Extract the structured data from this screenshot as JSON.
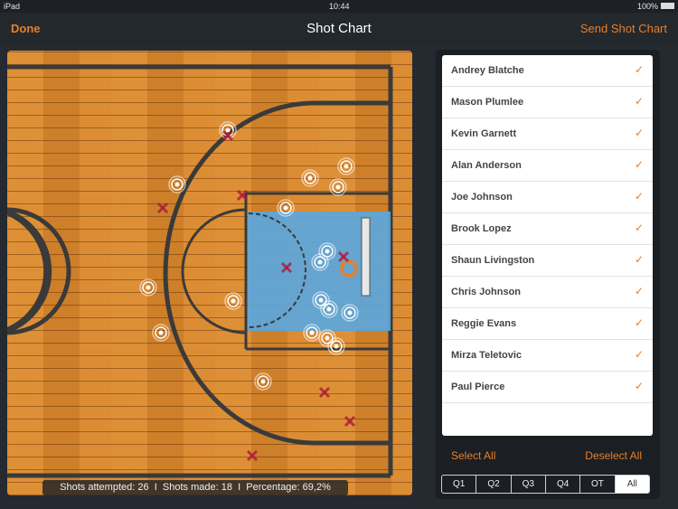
{
  "status": {
    "device": "iPad",
    "time": "10:44",
    "battery": "100%"
  },
  "nav": {
    "done": "Done",
    "title": "Shot Chart",
    "send": "Send Shot Chart"
  },
  "stats": {
    "attempted": "Shots attempted: 26",
    "made": "Shots made: 18",
    "percentage": "Percentage: 69,2%",
    "separator": "I"
  },
  "players": [
    {
      "name": "Andrey Blatche",
      "checked": true
    },
    {
      "name": "Mason Plumlee",
      "checked": true
    },
    {
      "name": "Kevin Garnett",
      "checked": true
    },
    {
      "name": "Alan Anderson",
      "checked": true
    },
    {
      "name": "Joe Johnson",
      "checked": true
    },
    {
      "name": "Brook Lopez",
      "checked": true
    },
    {
      "name": "Shaun Livingston",
      "checked": true
    },
    {
      "name": "Chris Johnson",
      "checked": true
    },
    {
      "name": "Reggie Evans",
      "checked": true
    },
    {
      "name": "Mirza Teletovic",
      "checked": true
    },
    {
      "name": "Paul Pierce",
      "checked": true
    }
  ],
  "check_glyph": "✓",
  "actions": {
    "select_all": "Select All",
    "deselect_all": "Deselect All"
  },
  "quarters": [
    "Q1",
    "Q2",
    "Q3",
    "Q4",
    "OT",
    "All"
  ],
  "selected_quarter": "All",
  "colors": {
    "accent": "#e77f2a",
    "paint": "#5ba7dc",
    "court": "#d9892f",
    "miss": "#b0183c"
  }
}
